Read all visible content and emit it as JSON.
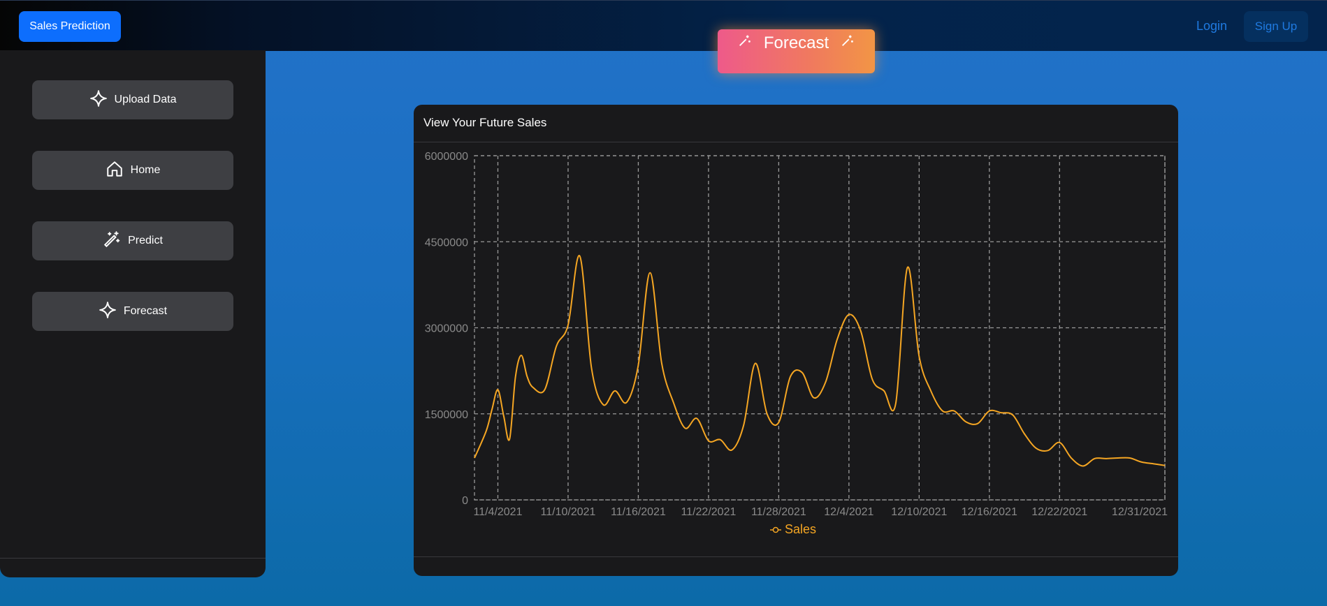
{
  "header": {
    "brand": "Sales Prediction",
    "login": "Login",
    "signup": "Sign Up",
    "forecast_button": "Forecast"
  },
  "sidebar": {
    "items": [
      {
        "label": "Upload Data",
        "icon": "sparkle-icon"
      },
      {
        "label": "Home",
        "icon": "home-icon"
      },
      {
        "label": "Predict",
        "icon": "magic-wand-icon"
      },
      {
        "label": "Forecast",
        "icon": "sparkle-icon"
      }
    ]
  },
  "panel": {
    "title": "View Your Future Sales"
  },
  "colors": {
    "accent": "#0d6efd",
    "series": "#f5a623",
    "panel_bg": "#19191b",
    "sidebar_btn": "#3e3f43"
  },
  "chart_data": {
    "type": "line",
    "title": "",
    "xlabel": "",
    "ylabel": "",
    "ylim": [
      0,
      6000000
    ],
    "yticks": [
      0,
      1500000,
      3000000,
      4500000,
      6000000
    ],
    "ytick_labels": [
      "0",
      "1500000",
      "3000000",
      "4500000",
      "6000000"
    ],
    "xticks": [
      "11/4/2021",
      "11/10/2021",
      "11/16/2021",
      "11/22/2021",
      "11/28/2021",
      "12/4/2021",
      "12/10/2021",
      "12/16/2021",
      "12/22/2021",
      "12/31/2021"
    ],
    "grid": true,
    "legend": "bottom-center",
    "series": [
      {
        "name": "Sales",
        "values": [
          [
            -2.0,
            730000
          ],
          [
            -1.0,
            1200000
          ],
          [
            -0.5,
            1580000
          ],
          [
            0.0,
            1920000
          ],
          [
            0.5,
            1460000
          ],
          [
            1.0,
            1060000
          ],
          [
            1.5,
            2140000
          ],
          [
            2.0,
            2520000
          ],
          [
            2.5,
            2150000
          ],
          [
            3.0,
            1960000
          ],
          [
            4.0,
            1920000
          ],
          [
            5.0,
            2680000
          ],
          [
            6.0,
            3050000
          ],
          [
            7.0,
            4250000
          ],
          [
            8.0,
            2300000
          ],
          [
            9.0,
            1660000
          ],
          [
            10.0,
            1900000
          ],
          [
            11.0,
            1700000
          ],
          [
            12.0,
            2350000
          ],
          [
            13.0,
            3960000
          ],
          [
            14.0,
            2380000
          ],
          [
            15.0,
            1700000
          ],
          [
            16.0,
            1250000
          ],
          [
            17.0,
            1420000
          ],
          [
            18.0,
            1030000
          ],
          [
            19.0,
            1050000
          ],
          [
            20.0,
            870000
          ],
          [
            21.0,
            1300000
          ],
          [
            22.0,
            2380000
          ],
          [
            23.0,
            1500000
          ],
          [
            24.0,
            1350000
          ],
          [
            25.0,
            2150000
          ],
          [
            26.0,
            2220000
          ],
          [
            27.0,
            1780000
          ],
          [
            28.0,
            2050000
          ],
          [
            29.0,
            2800000
          ],
          [
            30.0,
            3230000
          ],
          [
            31.0,
            2950000
          ],
          [
            32.0,
            2100000
          ],
          [
            33.0,
            1900000
          ],
          [
            34.0,
            1680000
          ],
          [
            35.0,
            4050000
          ],
          [
            36.0,
            2500000
          ],
          [
            37.0,
            1900000
          ],
          [
            38.0,
            1550000
          ],
          [
            39.0,
            1550000
          ],
          [
            40.0,
            1360000
          ],
          [
            41.0,
            1330000
          ],
          [
            42.0,
            1550000
          ],
          [
            43.0,
            1520000
          ],
          [
            44.0,
            1480000
          ],
          [
            45.0,
            1150000
          ],
          [
            46.0,
            900000
          ],
          [
            47.0,
            860000
          ],
          [
            48.0,
            1000000
          ],
          [
            49.0,
            730000
          ],
          [
            50.0,
            590000
          ],
          [
            51.0,
            720000
          ],
          [
            52.0,
            720000
          ],
          [
            53.0,
            730000
          ],
          [
            54.0,
            730000
          ],
          [
            55.0,
            660000
          ],
          [
            56.0,
            630000
          ],
          [
            57.0,
            600000
          ]
        ]
      }
    ]
  }
}
